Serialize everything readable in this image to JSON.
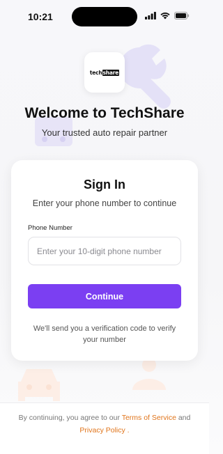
{
  "status_bar": {
    "time": "10:21",
    "icons": [
      "signal-icon",
      "wifi-icon",
      "battery-icon"
    ]
  },
  "logo": {
    "text_prefix": "tech",
    "text_highlight": "share"
  },
  "header": {
    "title": "Welcome to TechShare",
    "subtitle": "Your trusted auto repair partner"
  },
  "sign_in_card": {
    "title": "Sign In",
    "subtitle": "Enter your phone number to continue",
    "phone_label": "Phone Number",
    "phone_value": "",
    "phone_placeholder": "Enter your 10-digit phone number",
    "continue_label": "Continue",
    "verify_note": "We'll send you a verification code to verify your number"
  },
  "footer": {
    "prefix": "By continuing, you agree to our ",
    "terms_link": "Terms of Service",
    "and": " and ",
    "privacy_link": "Privacy Policy",
    "suffix": " ."
  },
  "colors": {
    "accent": "#7b3ff2",
    "link": "#e0741a",
    "deco_purple": "#e4e1f7",
    "deco_orange": "#fdeee6"
  }
}
